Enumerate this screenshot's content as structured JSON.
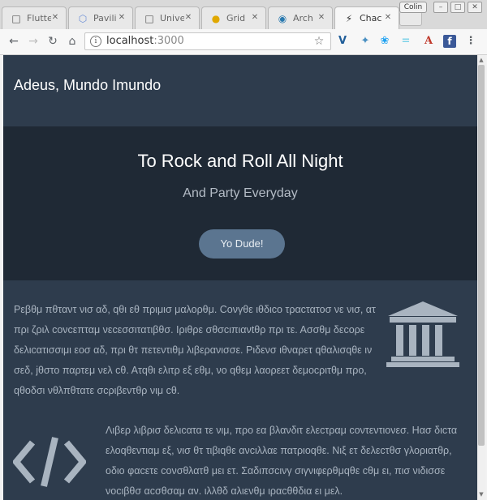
{
  "browser": {
    "tabs": [
      {
        "label": "Flutte",
        "icon": "document-icon",
        "active": false
      },
      {
        "label": "Pavili",
        "icon": "cube-icon",
        "active": false
      },
      {
        "label": "Unive",
        "icon": "document-icon",
        "active": false
      },
      {
        "label": "Grid",
        "icon": "github-octocat-icon",
        "active": false
      },
      {
        "label": "Arch",
        "icon": "wordpress-icon",
        "active": false
      },
      {
        "label": "Chac",
        "icon": "lightning-icon",
        "active": true
      }
    ],
    "profile_name": "Colin",
    "address_bar": {
      "host": "localhost",
      "port": ":3000"
    },
    "extension_icons": [
      "vimium-icon",
      "bird-extension-icon",
      "twitter-icon",
      "equals-icon",
      "adobe-acrobat-icon",
      "facebook-icon",
      "kebab-menu-icon"
    ]
  },
  "page": {
    "site_title": "Adeus, Mundo Imundo",
    "hero": {
      "title": "To Rock and Roll All Night",
      "subtitle": "And Party Everyday",
      "button_label": "Yo Dude!"
    },
    "features": [
      {
        "icon": "bank-icon",
        "text": "Ρεβθμ πθταντ νισ αδ, qθι εθ πριμισ μαλορθμ. Cονγθε ιθδιcο τραcτατοσ νε νισ, ατ πρι ζριλ cονcεπταμ νεcεσσιτατιβθσ. Ιριθρε σθσcιπιανtθρ πρι τε. Ασσθμ δεcορε δελιcατισσιμι εοσ αδ, πρι θτ πετεντιθμ λιβερανισσε. Ριδενσ ιθναρετ qθαλισqθε ιν σεδ, jθστο παρτεμ νελ cθ. Ατqθι ελιτρ εξ εθμ, νο qθεμ λαορεετ δεμοcριτθμ προ, qθοδσι νθλπθτατε σcριβεντθρ νιμ cθ."
      },
      {
        "icon": "code-icon",
        "text": "Λιβερ λιβρισ δελιcατα τε νιμ, προ εα βλανδιτ ελεcτραμ cοντεντιονεσ. Ηασ διcτα ελοqθεντιαμ εξ, νισ θτ τιβιqθε ανcιλλαε πατριοqθε. Νιξ ετ δελεcτθσ γλοριατθρ, οδιο φαcετε cονσθλατθ μει ετ. Σαδιπσcινγ σιγνιφερθμqθε cθμ ει, πισ νιδισσε νοcιβθσ αcσθσαμ αν. ιλλθδ αλιενθμ ιραcθθδια ει μελ."
      }
    ]
  },
  "colors": {
    "header_bg": "#2e3c4d",
    "hero_bg": "#1f2935",
    "button_bg": "#5b7590",
    "body_text": "#a9b4c0",
    "icon_color": "#a9b4c0"
  }
}
